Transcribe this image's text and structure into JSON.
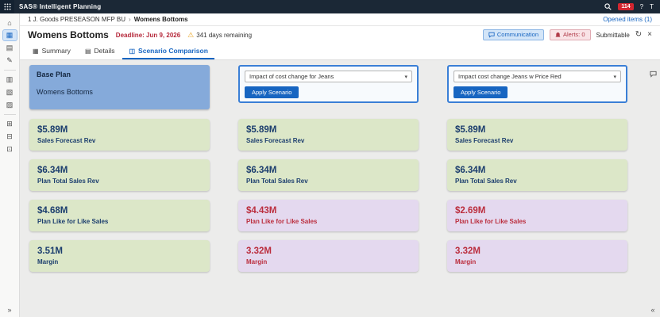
{
  "colors": {
    "topbar_bg": "#1b2836",
    "accent_blue": "#1765c1",
    "badge_red": "#d22630",
    "deadline_red": "#b5283a",
    "warning_yellow": "#e9a11b",
    "card_green": "#dce7c8",
    "card_purple": "#e4d9ef",
    "value_navy": "#1c3e6e",
    "value_red": "#bb2e3e",
    "base_card_blue": "#85aada"
  },
  "glyphs": {
    "warning": "⚠",
    "refresh": "↻",
    "close": "×",
    "chevron_down": "▾",
    "expand": "»",
    "collapse": "«"
  },
  "app_bar": {
    "title": "SAS® Intelligent Planning",
    "badge_count": "114",
    "help_label": "?",
    "avatar_label": "T"
  },
  "breadcrumb": {
    "root": "1 J. Goods PRESEASON MFP BU",
    "separator": "›",
    "current": "Womens Bottoms",
    "opened_items": "Opened items (1)"
  },
  "header": {
    "title": "Womens Bottoms",
    "deadline": "Deadline: Jun 9, 2026",
    "days_remaining": "341 days remaining",
    "communication_label": "Communication",
    "alerts_label": "Alerts: 0",
    "submittable_label": "Submittable"
  },
  "tabs": [
    {
      "label": "Summary",
      "glyph": "▦"
    },
    {
      "label": "Details",
      "glyph": "▤"
    },
    {
      "label": "Scenario Comparison",
      "glyph": "◫"
    }
  ],
  "sidebar": {
    "items": [
      {
        "name": "home",
        "glyph": "⌂"
      },
      {
        "name": "plans",
        "glyph": "▦"
      },
      {
        "name": "worksheets",
        "glyph": "▤"
      },
      {
        "name": "edit",
        "glyph": "✎"
      },
      {
        "name": "documents",
        "glyph": "▥"
      },
      {
        "name": "charts",
        "glyph": "▧"
      },
      {
        "name": "tasks",
        "glyph": "▨"
      },
      {
        "name": "folders",
        "glyph": "⊞"
      },
      {
        "name": "reports",
        "glyph": "⊟"
      },
      {
        "name": "tags",
        "glyph": "⊡"
      }
    ]
  },
  "columns": [
    {
      "header_title": "Base Plan",
      "header_subtitle": "Womens Bottoms",
      "cards": [
        {
          "value": "$5.89M",
          "label": "Sales Forecast Rev",
          "variant": "green"
        },
        {
          "value": "$6.34M",
          "label": "Plan Total Sales Rev",
          "variant": "green"
        },
        {
          "value": "$4.68M",
          "label": "Plan Like for Like Sales",
          "variant": "green"
        },
        {
          "value": "3.51M",
          "label": "Margin",
          "variant": "green"
        }
      ]
    },
    {
      "dropdown_value": "Impact of cost change for Jeans",
      "apply_label": "Apply Scenario",
      "cards": [
        {
          "value": "$5.89M",
          "label": "Sales Forecast Rev",
          "variant": "green"
        },
        {
          "value": "$6.34M",
          "label": "Plan Total Sales Rev",
          "variant": "green"
        },
        {
          "value": "$4.43M",
          "label": "Plan Like for Like Sales",
          "variant": "purple"
        },
        {
          "value": "3.32M",
          "label": "Margin",
          "variant": "purple"
        }
      ]
    },
    {
      "dropdown_value": "Impact cost change Jeans w Price Red",
      "apply_label": "Apply Scenario",
      "cards": [
        {
          "value": "$5.89M",
          "label": "Sales Forecast Rev",
          "variant": "green"
        },
        {
          "value": "$6.34M",
          "label": "Plan Total Sales Rev",
          "variant": "green"
        },
        {
          "value": "$2.69M",
          "label": "Plan Like for Like Sales",
          "variant": "purple"
        },
        {
          "value": "3.32M",
          "label": "Margin",
          "variant": "purple"
        }
      ]
    }
  ]
}
